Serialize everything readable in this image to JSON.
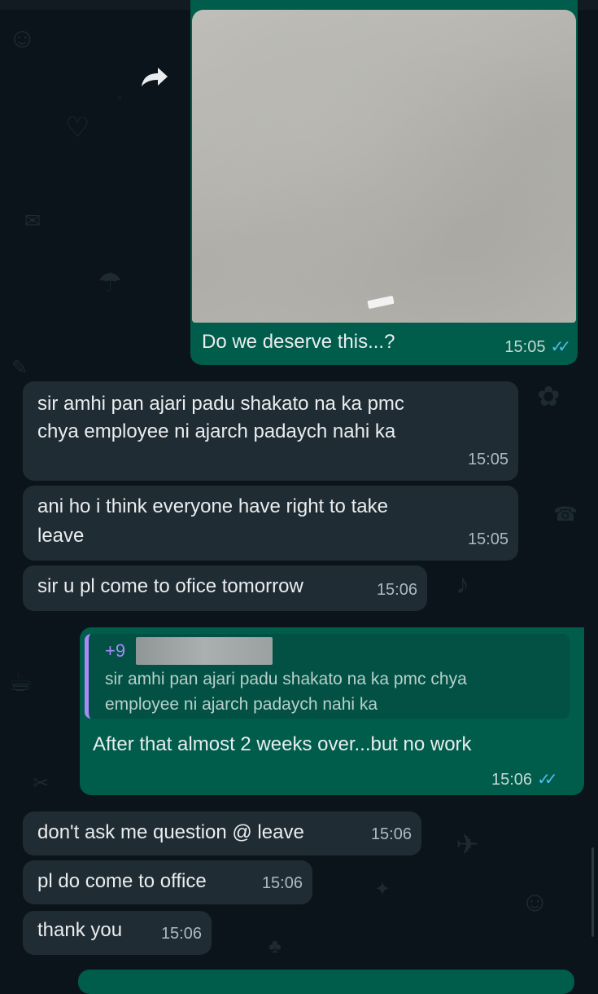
{
  "messages": [
    {
      "id": "m1",
      "direction": "outgoing",
      "caption": "Do we deserve this...?",
      "time": "15:05",
      "status": "read",
      "has_image": true
    },
    {
      "id": "m2",
      "direction": "incoming",
      "line1": "sir amhi pan ajari padu shakato na ka pmc",
      "line2": "chya employee ni ajarch padaych nahi ka",
      "time": "15:05"
    },
    {
      "id": "m3",
      "direction": "incoming",
      "line1": "ani ho i think everyone have right to take",
      "line2": "leave",
      "time": "15:05"
    },
    {
      "id": "m4",
      "direction": "incoming",
      "text": "sir u pl come to ofice tomorrow",
      "time": "15:06"
    },
    {
      "id": "m5",
      "direction": "outgoing",
      "reply": {
        "sender": "+9",
        "line1": "sir amhi pan ajari padu shakato na ka pmc chya",
        "line2": "employee ni ajarch padaych nahi ka"
      },
      "text": "After that almost 2 weeks over...but no work",
      "time": "15:06",
      "status": "read"
    },
    {
      "id": "m6",
      "direction": "incoming",
      "text": "don't ask me question @ leave",
      "time": "15:06"
    },
    {
      "id": "m7",
      "direction": "incoming",
      "text": "pl do come to office",
      "time": "15:06"
    },
    {
      "id": "m8",
      "direction": "incoming",
      "text": "thank you",
      "time": "15:06"
    }
  ],
  "icons": {
    "forward": "forward-arrow-icon",
    "read_receipt": "double-check-icon"
  },
  "colors": {
    "incoming": "#202c33",
    "outgoing": "#005c4b",
    "read_ticks": "#53bdeb",
    "reply_accent": "#a78bfa"
  }
}
